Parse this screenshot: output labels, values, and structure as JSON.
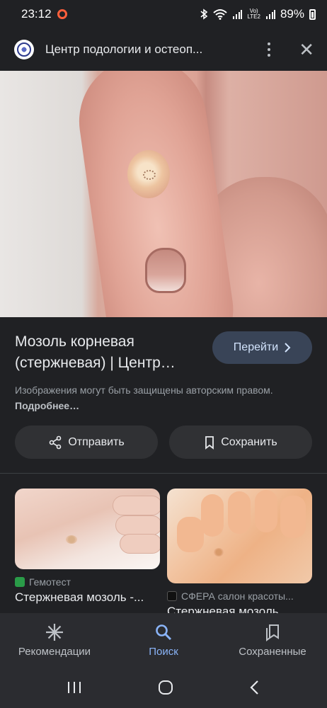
{
  "status_bar": {
    "time": "23:12",
    "battery": "89%",
    "network": "LTE2",
    "volte": "Vo)"
  },
  "header": {
    "site_title": "Центр подологии и остеоп...",
    "menu_icon": "more-vert-icon",
    "close_icon": "close-icon"
  },
  "hero": {
    "lens_icon": "google-lens-icon"
  },
  "result": {
    "title_line1": "Мозоль корневая",
    "title_line2": "(стержневая) | Центр…",
    "visit_label": "Перейти",
    "copyright_text": "Изображения могут быть защищены авторским правом.",
    "more_link": "Подробнее…",
    "share_label": "Отправить",
    "save_label": "Сохранить"
  },
  "related": [
    {
      "source": "Гемотест",
      "title": "Стержневая мозоль -..."
    },
    {
      "source": "СФЕРА салон красоты...",
      "title": "Стержневая мозоль"
    }
  ],
  "bottom_nav": [
    {
      "label": "Рекомендации",
      "icon": "discover-asterisk-icon",
      "active": false
    },
    {
      "label": "Поиск",
      "icon": "search-icon",
      "active": true
    },
    {
      "label": "Сохраненные",
      "icon": "saved-collections-icon",
      "active": false
    }
  ],
  "colors": {
    "background": "#202124",
    "accent": "#8ab4f8",
    "visit_button": "#394457"
  }
}
